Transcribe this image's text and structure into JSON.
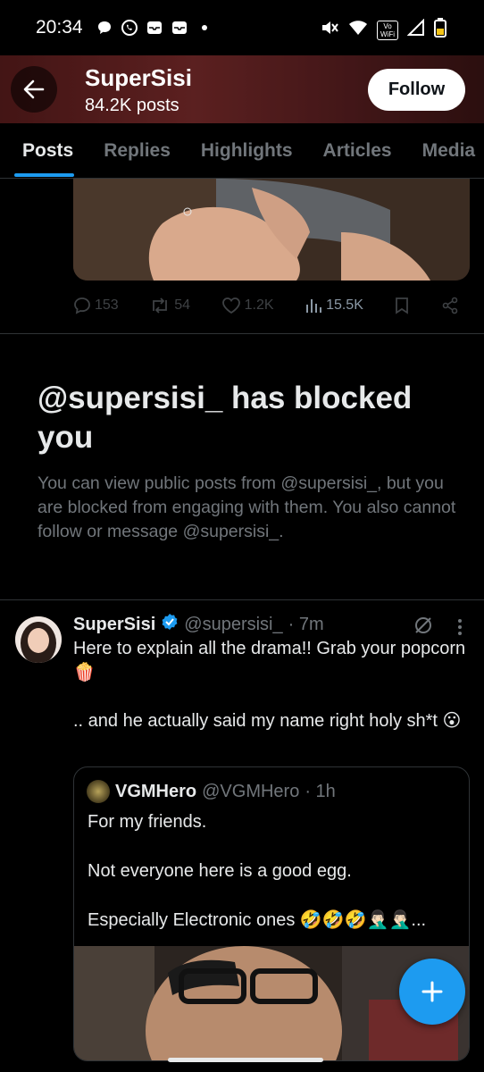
{
  "status_bar": {
    "time": "20:34",
    "vowifi_label": "Vo WiFi"
  },
  "header": {
    "title": "SuperSisi",
    "posts_count": "84.2K posts",
    "follow_label": "Follow"
  },
  "tabs": [
    {
      "label": "Posts",
      "active": true
    },
    {
      "label": "Replies",
      "active": false
    },
    {
      "label": "Highlights",
      "active": false
    },
    {
      "label": "Articles",
      "active": false
    },
    {
      "label": "Media",
      "active": false
    }
  ],
  "prev_tweet_actions": {
    "replies": "153",
    "reposts": "54",
    "likes": "1.2K",
    "views": "15.5K"
  },
  "blocked": {
    "title": "@supersisi_ has blocked you",
    "text": "You can view public posts from @supersisi_, but you are blocked from engaging with them. You also cannot follow or message @supersisi_."
  },
  "tweet": {
    "name": "SuperSisi",
    "handle": "@supersisi_",
    "time": "· 7m",
    "body": "Here to explain all the drama!! Grab your popcorn 🍿\n\n.. and he actually said my name right holy sh*t 😮"
  },
  "quote": {
    "name": "VGMHero",
    "handle": "@VGMHero",
    "time": "· 1h",
    "body": "For my friends.\n\nNot everyone here is a good egg.\n\nEspecially Electronic ones 🤣🤣🤣🤦🏻‍♂️🤦🏻‍♂️..."
  },
  "colors": {
    "accent": "#1d9bf0",
    "muted": "#71767b",
    "background": "#000000"
  }
}
